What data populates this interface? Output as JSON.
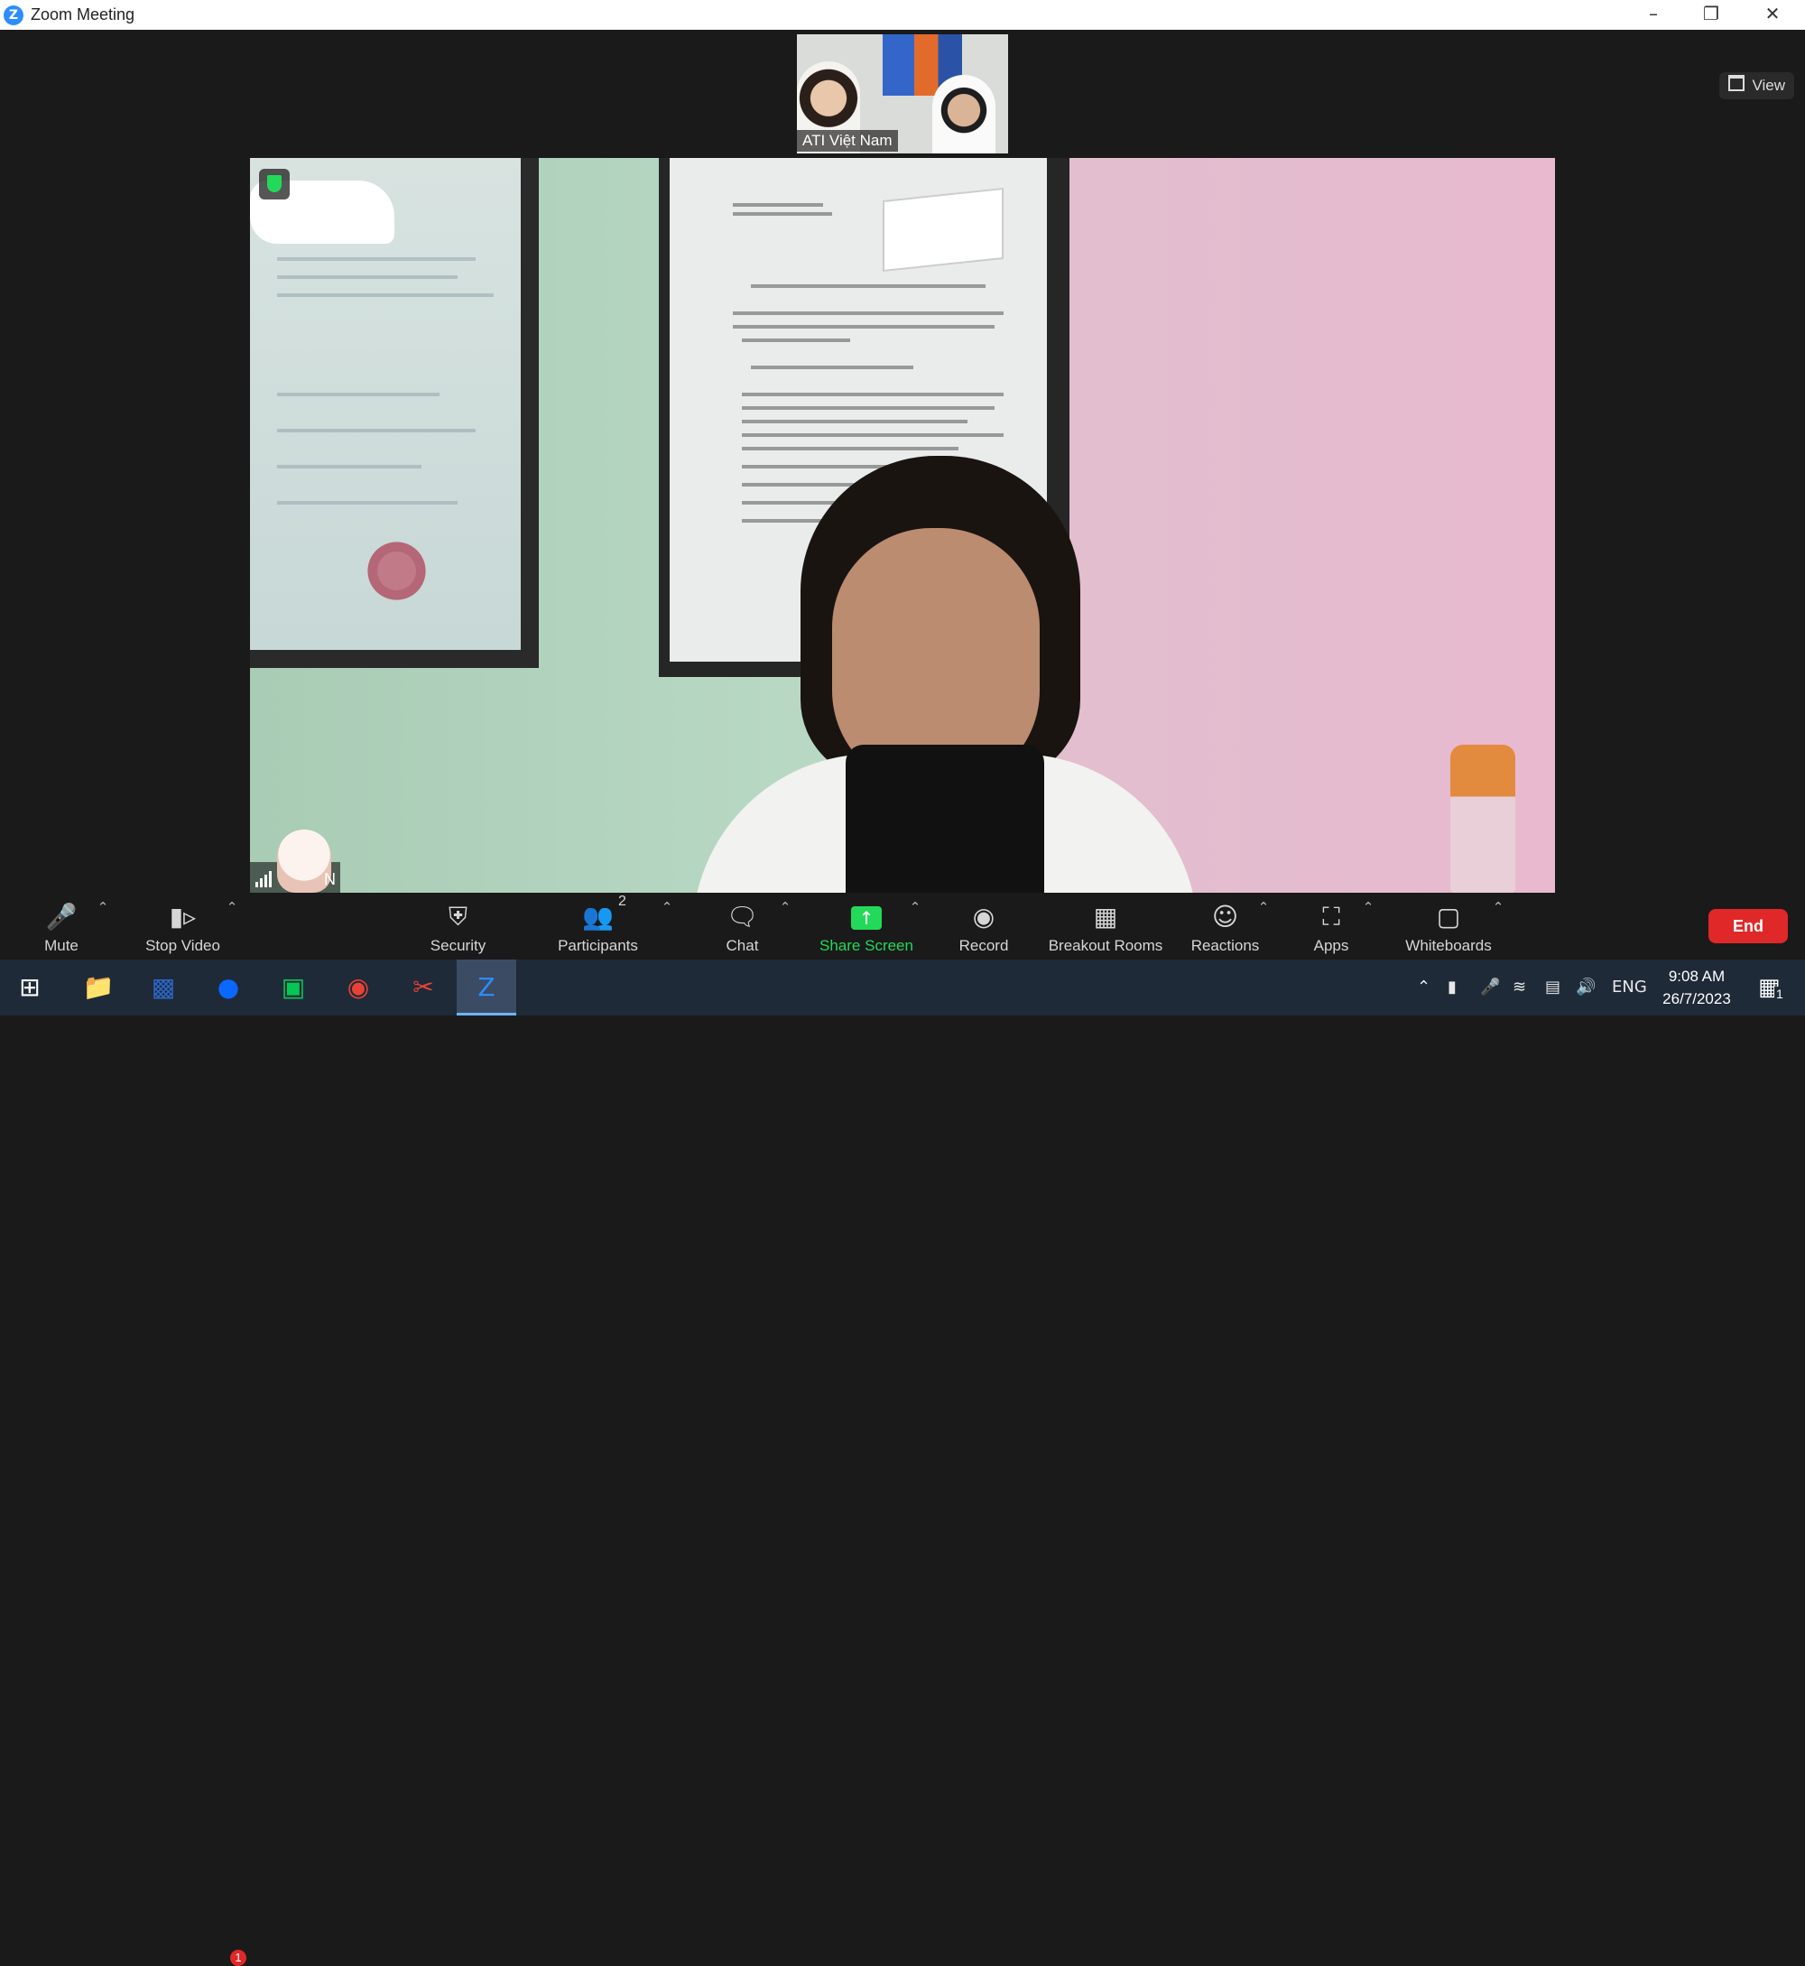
{
  "window": {
    "title": "Zoom Meeting",
    "controls": [
      "minimize",
      "restore",
      "close"
    ]
  },
  "view_button": {
    "label": "View"
  },
  "thumbnail": {
    "name": "ATI Việt Nam"
  },
  "self_tile": {
    "initial": "N"
  },
  "toolbar": {
    "mute": "Mute",
    "stop_video": "Stop Video",
    "security": "Security",
    "participants": "Participants",
    "participants_count": "2",
    "chat": "Chat",
    "share_screen": "Share Screen",
    "record": "Record",
    "breakout_rooms": "Breakout Rooms",
    "reactions": "Reactions",
    "apps": "Apps",
    "whiteboards": "Whiteboards",
    "end": "End"
  },
  "taskbar": {
    "zalo_badge": "1",
    "language": "ENG",
    "time": "9:08 AM",
    "date": "26/7/2023",
    "notification_count": "1"
  },
  "colors": {
    "accent": "#23d959",
    "end": "#e02828",
    "zoom_blue": "#2D8CFF"
  }
}
